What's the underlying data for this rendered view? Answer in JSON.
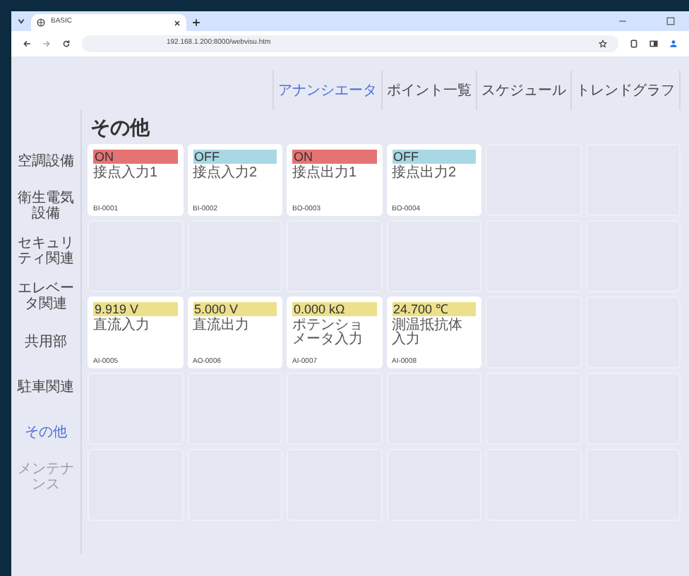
{
  "browser": {
    "tab_title": "BASIC",
    "url": "192.168.1.200:8000/webvisu.htm"
  },
  "nav": [
    {
      "label": "アナンシエータ",
      "selected": true
    },
    {
      "label": "ポイント一覧",
      "selected": false
    },
    {
      "label": "スケジュール",
      "selected": false
    },
    {
      "label": "トレンドグラフ",
      "selected": false
    }
  ],
  "title": "その他",
  "sidebar": [
    {
      "label": "空調設備",
      "selected": false,
      "disabled": false
    },
    {
      "label": "衛生電気設備",
      "selected": false,
      "disabled": false
    },
    {
      "label": "セキュリティ関連",
      "selected": false,
      "disabled": false
    },
    {
      "label": "エレベータ関連",
      "selected": false,
      "disabled": false
    },
    {
      "label": "共用部",
      "selected": false,
      "disabled": false
    },
    {
      "label": "駐車関連",
      "selected": false,
      "disabled": false
    },
    {
      "label": "その他",
      "selected": true,
      "disabled": false
    },
    {
      "label": "メンテナンス",
      "selected": false,
      "disabled": true
    }
  ],
  "slots": [
    {
      "kind": "point",
      "value": "ON",
      "color": "#e57373",
      "description": "接点入力1",
      "id": "BI-0001"
    },
    {
      "kind": "point",
      "value": "OFF",
      "color": "#a8d8e4",
      "description": "接点入力2",
      "id": "BI-0002"
    },
    {
      "kind": "point",
      "value": "ON",
      "color": "#e57373",
      "description": "接点出力1",
      "id": "BO-0003"
    },
    {
      "kind": "point",
      "value": "OFF",
      "color": "#a8d8e4",
      "description": "接点出力2",
      "id": "BO-0004"
    },
    {
      "kind": "empty"
    },
    {
      "kind": "empty"
    },
    {
      "kind": "empty"
    },
    {
      "kind": "empty"
    },
    {
      "kind": "empty"
    },
    {
      "kind": "empty"
    },
    {
      "kind": "empty"
    },
    {
      "kind": "empty"
    },
    {
      "kind": "point",
      "value": "9.919 V",
      "color": "#ece08c",
      "description": "直流入力",
      "id": "AI-0005"
    },
    {
      "kind": "point",
      "value": "5.000 V",
      "color": "#ece08c",
      "description": "直流出力",
      "id": "AO-0006"
    },
    {
      "kind": "point",
      "value": "0.000 kΩ",
      "color": "#ece08c",
      "description": "ポテンショメータ入力",
      "id": "AI-0007"
    },
    {
      "kind": "point",
      "value": "24.700 ℃",
      "color": "#ece08c",
      "description": "測温抵抗体入力",
      "id": "AI-0008"
    },
    {
      "kind": "empty"
    },
    {
      "kind": "empty"
    },
    {
      "kind": "empty"
    },
    {
      "kind": "empty"
    },
    {
      "kind": "empty"
    },
    {
      "kind": "empty"
    },
    {
      "kind": "empty"
    },
    {
      "kind": "empty"
    },
    {
      "kind": "empty"
    },
    {
      "kind": "empty"
    },
    {
      "kind": "empty"
    },
    {
      "kind": "empty"
    },
    {
      "kind": "empty"
    },
    {
      "kind": "empty"
    }
  ]
}
